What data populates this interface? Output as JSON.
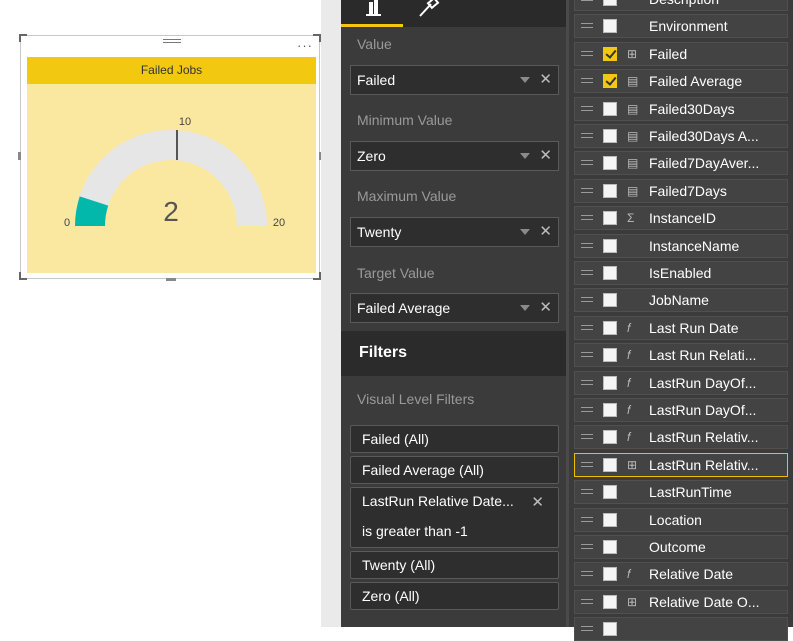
{
  "visual": {
    "title": "Failed Jobs",
    "gauge": {
      "value": 2,
      "min": 0,
      "max": 20,
      "target": 10,
      "value_label": "2",
      "min_label": "0",
      "max_label": "20",
      "target_label": "10"
    },
    "more_label": "···"
  },
  "wells": [
    {
      "label": "Value",
      "value": "Failed"
    },
    {
      "label": "Minimum Value",
      "value": "Zero"
    },
    {
      "label": "Maximum Value",
      "value": "Twenty"
    },
    {
      "label": "Target Value",
      "value": "Failed Average"
    }
  ],
  "filters": {
    "title": "Filters",
    "section": "Visual Level Filters",
    "items": [
      {
        "label": "Failed (All)"
      },
      {
        "label": "Failed Average (All)"
      },
      {
        "label": "LastRun Relative Date...",
        "sub": "is greater than -1"
      },
      {
        "label": "Twenty (All)"
      },
      {
        "label": "Zero (All)"
      }
    ]
  },
  "fields": [
    {
      "name": "Description",
      "checked": false,
      "icon": ""
    },
    {
      "name": "Environment",
      "checked": false,
      "icon": ""
    },
    {
      "name": "Failed",
      "checked": true,
      "icon": "hierarchy"
    },
    {
      "name": "Failed Average",
      "checked": true,
      "icon": "calc"
    },
    {
      "name": "Failed30Days",
      "checked": false,
      "icon": "calc"
    },
    {
      "name": "Failed30Days A...",
      "checked": false,
      "icon": "calc"
    },
    {
      "name": "Failed7DayAver...",
      "checked": false,
      "icon": "calc"
    },
    {
      "name": "Failed7Days",
      "checked": false,
      "icon": "calc"
    },
    {
      "name": "InstanceID",
      "checked": false,
      "icon": "sigma"
    },
    {
      "name": "InstanceName",
      "checked": false,
      "icon": ""
    },
    {
      "name": "IsEnabled",
      "checked": false,
      "icon": ""
    },
    {
      "name": "JobName",
      "checked": false,
      "icon": ""
    },
    {
      "name": "Last Run Date",
      "checked": false,
      "icon": "fx"
    },
    {
      "name": "Last Run Relati...",
      "checked": false,
      "icon": "fx"
    },
    {
      "name": "LastRun DayOf...",
      "checked": false,
      "icon": "fx"
    },
    {
      "name": "LastRun DayOf...",
      "checked": false,
      "icon": "fx"
    },
    {
      "name": "LastRun Relativ...",
      "checked": false,
      "icon": "fx"
    },
    {
      "name": "LastRun Relativ...",
      "checked": false,
      "icon": "hierarchy",
      "selected": true
    },
    {
      "name": "LastRunTime",
      "checked": false,
      "icon": ""
    },
    {
      "name": "Location",
      "checked": false,
      "icon": ""
    },
    {
      "name": "Outcome",
      "checked": false,
      "icon": ""
    },
    {
      "name": "Relative Date",
      "checked": false,
      "icon": "fx"
    },
    {
      "name": "Relative Date O...",
      "checked": false,
      "icon": "hierarchy"
    },
    {
      "name": "",
      "checked": false,
      "icon": ""
    }
  ],
  "colors": {
    "accent": "#f2c811",
    "gauge_fill": "#01b8aa",
    "gauge_track": "#e6e6e6",
    "visual_bg": "#fbe8a0"
  }
}
